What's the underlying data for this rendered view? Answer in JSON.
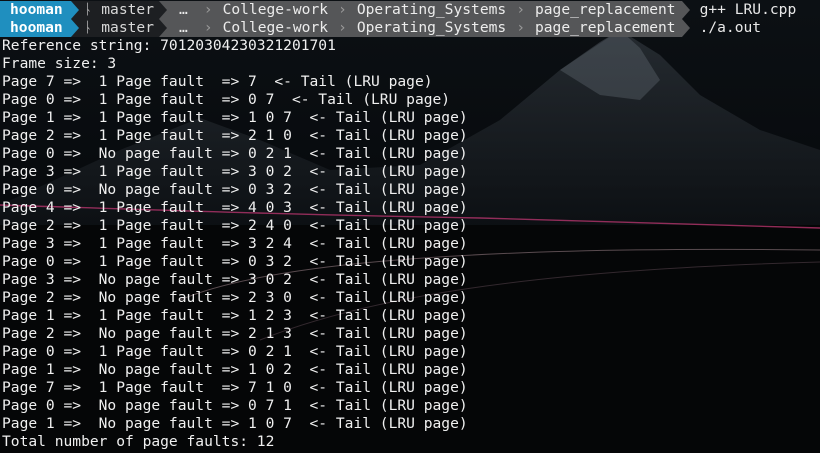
{
  "prompts": [
    {
      "user": "hooman",
      "branch_icon": "git-branch-icon",
      "branch": "master",
      "path": [
        "…",
        "College-work",
        "Operating_Systems",
        "page_replacement"
      ],
      "command": "g++ LRU.cpp"
    },
    {
      "user": "hooman",
      "branch_icon": "git-branch-icon",
      "branch": "master",
      "path": [
        "…",
        "College-work",
        "Operating_Systems",
        "page_replacement"
      ],
      "command": "./a.out"
    }
  ],
  "output": [
    "Reference string: 70120304230321201701",
    "Frame size: 3",
    "Page 7 =>  1 Page fault  => 7  <- Tail (LRU page)",
    "Page 0 =>  1 Page fault  => 0 7  <- Tail (LRU page)",
    "Page 1 =>  1 Page fault  => 1 0 7  <- Tail (LRU page)",
    "Page 2 =>  1 Page fault  => 2 1 0  <- Tail (LRU page)",
    "Page 0 =>  No page fault => 0 2 1  <- Tail (LRU page)",
    "Page 3 =>  1 Page fault  => 3 0 2  <- Tail (LRU page)",
    "Page 0 =>  No page fault => 0 3 2  <- Tail (LRU page)",
    "Page 4 =>  1 Page fault  => 4 0 3  <- Tail (LRU page)",
    "Page 2 =>  1 Page fault  => 2 4 0  <- Tail (LRU page)",
    "Page 3 =>  1 Page fault  => 3 2 4  <- Tail (LRU page)",
    "Page 0 =>  1 Page fault  => 0 3 2  <- Tail (LRU page)",
    "Page 3 =>  No page fault => 3 0 2  <- Tail (LRU page)",
    "Page 2 =>  No page fault => 2 3 0  <- Tail (LRU page)",
    "Page 1 =>  1 Page fault  => 1 2 3  <- Tail (LRU page)",
    "Page 2 =>  No page fault => 2 1 3  <- Tail (LRU page)",
    "Page 0 =>  1 Page fault  => 0 2 1  <- Tail (LRU page)",
    "Page 1 =>  No page fault => 1 0 2  <- Tail (LRU page)",
    "Page 7 =>  1 Page fault  => 7 1 0  <- Tail (LRU page)",
    "Page 0 =>  No page fault => 0 7 1  <- Tail (LRU page)",
    "Page 1 =>  No page fault => 1 0 7  <- Tail (LRU page)",
    "Total number of page faults: 12"
  ]
}
